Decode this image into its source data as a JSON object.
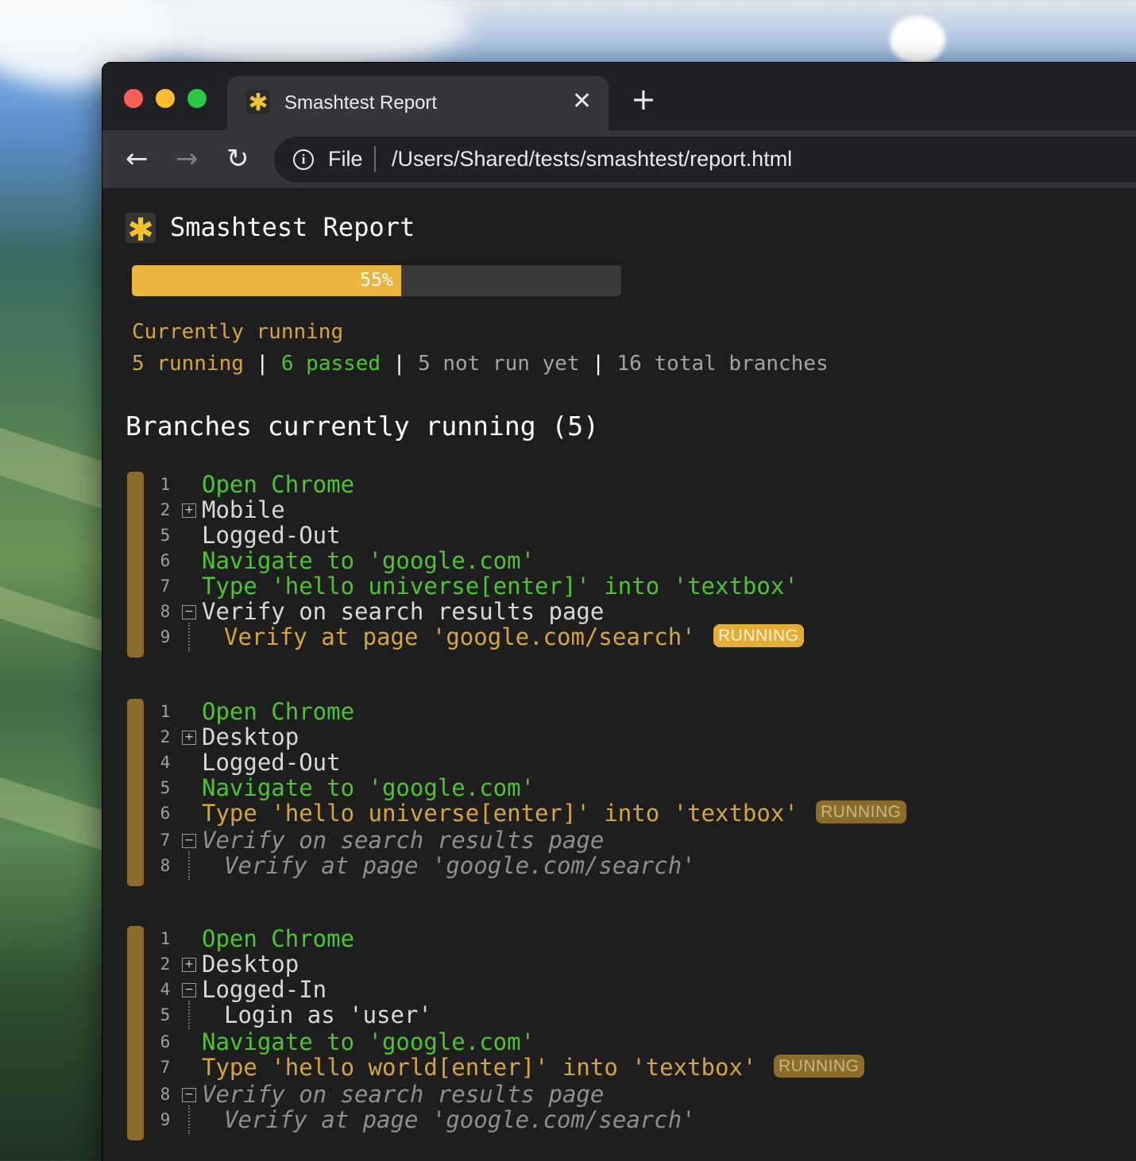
{
  "browser": {
    "tab": {
      "title": "Smashtest Report",
      "favicon_glyph": "✱",
      "close_glyph": "✕"
    },
    "new_tab_glyph": "+",
    "nav": {
      "back_glyph": "←",
      "forward_glyph": "→",
      "reload_glyph": "↻"
    },
    "omnibox": {
      "info_glyph": "i",
      "scheme_label": "File",
      "url": "/Users/Shared/tests/smashtest/report.html"
    }
  },
  "report": {
    "logo_glyph": "✱",
    "title": "Smashtest Report",
    "progress": {
      "percent": 55,
      "label": "55%",
      "color": "#eab63e"
    },
    "status_heading": "Currently running",
    "counts": {
      "running": "5 running",
      "passed": "6 passed",
      "not_run": "5 not run yet",
      "total": "16 total branches",
      "separator": "|"
    },
    "section_title": "Branches currently running (5)",
    "branches": [
      {
        "steps": [
          {
            "line": "1",
            "text": "Open Chrome",
            "state": "passed",
            "indent": 0,
            "toggle": ""
          },
          {
            "line": "2",
            "text": "Mobile",
            "state": "plain",
            "indent": 0,
            "toggle": "+"
          },
          {
            "line": "5",
            "text": "Logged-Out",
            "state": "plain",
            "indent": 0,
            "toggle": ""
          },
          {
            "line": "6",
            "text": "Navigate to 'google.com'",
            "state": "passed",
            "indent": 0,
            "toggle": ""
          },
          {
            "line": "7",
            "text": "Type 'hello universe[enter]' into 'textbox'",
            "state": "passed",
            "indent": 0,
            "toggle": ""
          },
          {
            "line": "8",
            "text": "Verify on search results page",
            "state": "plain",
            "indent": 0,
            "toggle": "−"
          },
          {
            "line": "9",
            "text": "Verify at page 'google.com/search'",
            "state": "running",
            "indent": 1,
            "toggle": "",
            "badge": "RUNNING",
            "badge_style": "bright"
          }
        ]
      },
      {
        "steps": [
          {
            "line": "1",
            "text": "Open Chrome",
            "state": "passed",
            "indent": 0,
            "toggle": ""
          },
          {
            "line": "2",
            "text": "Desktop",
            "state": "plain",
            "indent": 0,
            "toggle": "+"
          },
          {
            "line": "4",
            "text": "Logged-Out",
            "state": "plain",
            "indent": 0,
            "toggle": ""
          },
          {
            "line": "5",
            "text": "Navigate to 'google.com'",
            "state": "passed",
            "indent": 0,
            "toggle": ""
          },
          {
            "line": "6",
            "text": "Type 'hello universe[enter]' into 'textbox'",
            "state": "running",
            "indent": 0,
            "toggle": "",
            "badge": "RUNNING",
            "badge_style": "dim"
          },
          {
            "line": "7",
            "text": "Verify on search results page",
            "state": "pending",
            "indent": 0,
            "toggle": "−"
          },
          {
            "line": "8",
            "text": "Verify at page 'google.com/search'",
            "state": "pending",
            "indent": 1,
            "toggle": ""
          }
        ]
      },
      {
        "steps": [
          {
            "line": "1",
            "text": "Open Chrome",
            "state": "passed",
            "indent": 0,
            "toggle": ""
          },
          {
            "line": "2",
            "text": "Desktop",
            "state": "plain",
            "indent": 0,
            "toggle": "+"
          },
          {
            "line": "4",
            "text": "Logged-In",
            "state": "plain",
            "indent": 0,
            "toggle": "−"
          },
          {
            "line": "5",
            "text": "Login as 'user'",
            "state": "plain",
            "indent": 1,
            "toggle": ""
          },
          {
            "line": "6",
            "text": "Navigate to 'google.com'",
            "state": "passed",
            "indent": 0,
            "toggle": ""
          },
          {
            "line": "7",
            "text": "Type 'hello world[enter]' into 'textbox'",
            "state": "running",
            "indent": 0,
            "toggle": "",
            "badge": "RUNNING",
            "badge_style": "dim"
          },
          {
            "line": "8",
            "text": "Verify on search results page",
            "state": "pending",
            "indent": 0,
            "toggle": "−"
          },
          {
            "line": "9",
            "text": "Verify at page 'google.com/search'",
            "state": "pending",
            "indent": 1,
            "toggle": ""
          }
        ]
      }
    ]
  }
}
